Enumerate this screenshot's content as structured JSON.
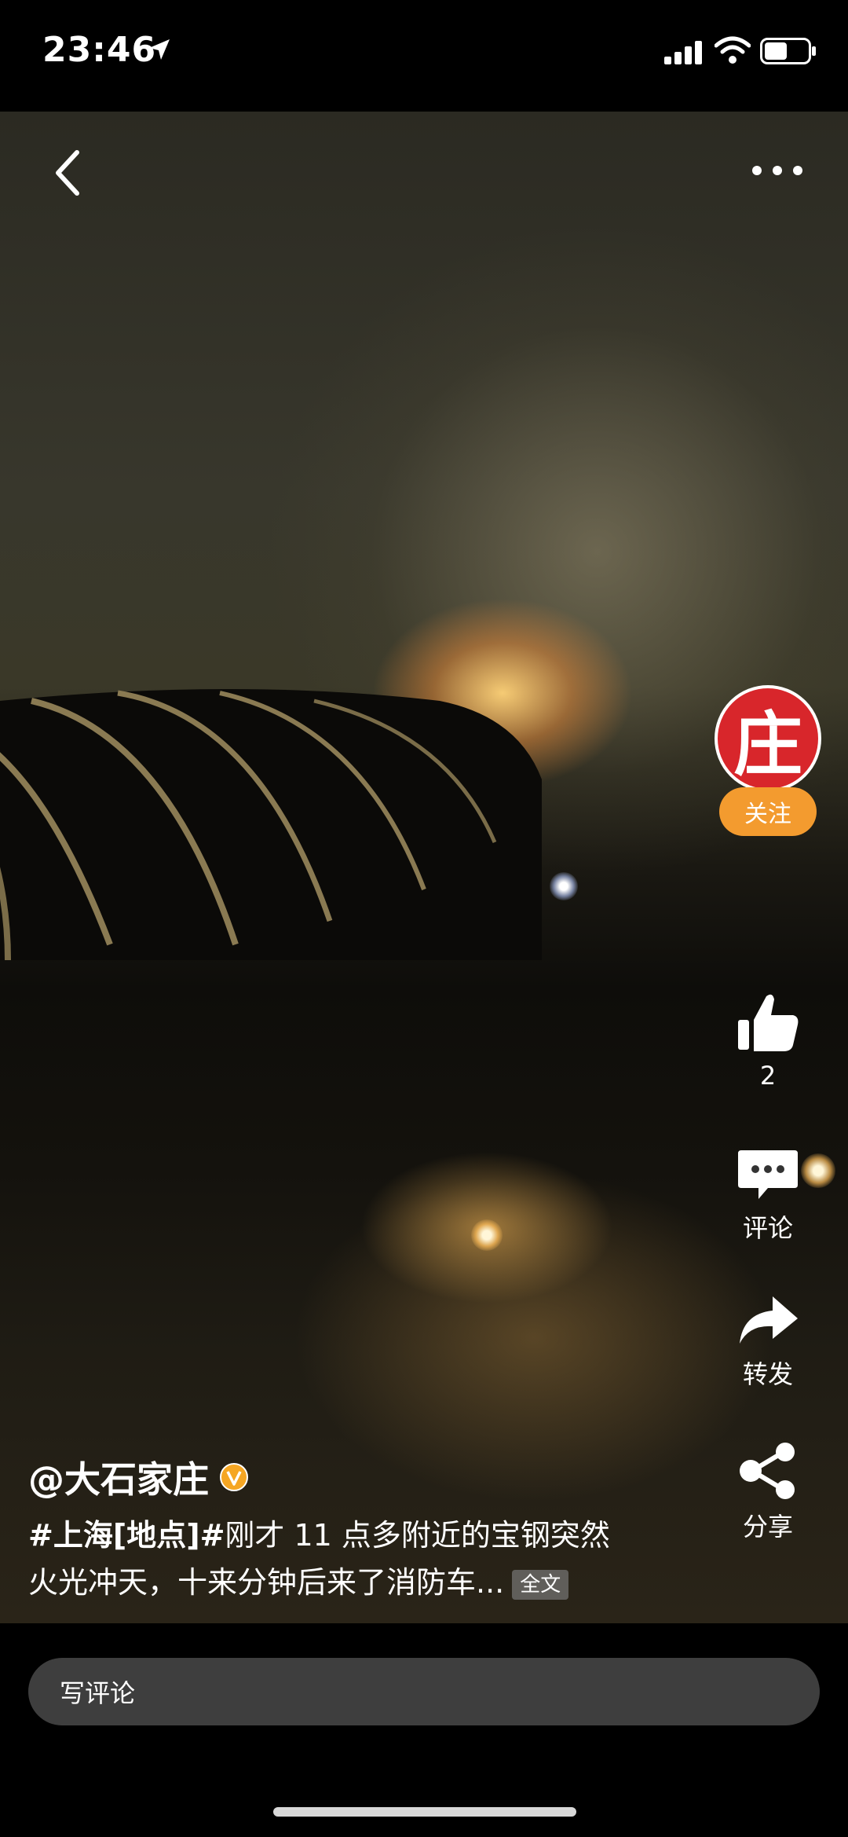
{
  "status_bar": {
    "time": "23:46"
  },
  "post": {
    "author": "@大石家庄",
    "avatar_char": "庄",
    "follow_label": "关注",
    "caption_tag": "#上海[地点]#",
    "caption_text": "刚才 11 点多附近的宝钢突然火光冲天，十来分钟后来了消防车...",
    "full_text_label": "全文"
  },
  "actions": {
    "like_count": "2",
    "comment_label": "评论",
    "share_label": "转发",
    "forward_label": "分享"
  },
  "comment_input": {
    "placeholder": "写评论"
  },
  "colors": {
    "avatar": "#d8262b",
    "follow": "#f39b2f",
    "input_bg": "#3e3e3e"
  }
}
